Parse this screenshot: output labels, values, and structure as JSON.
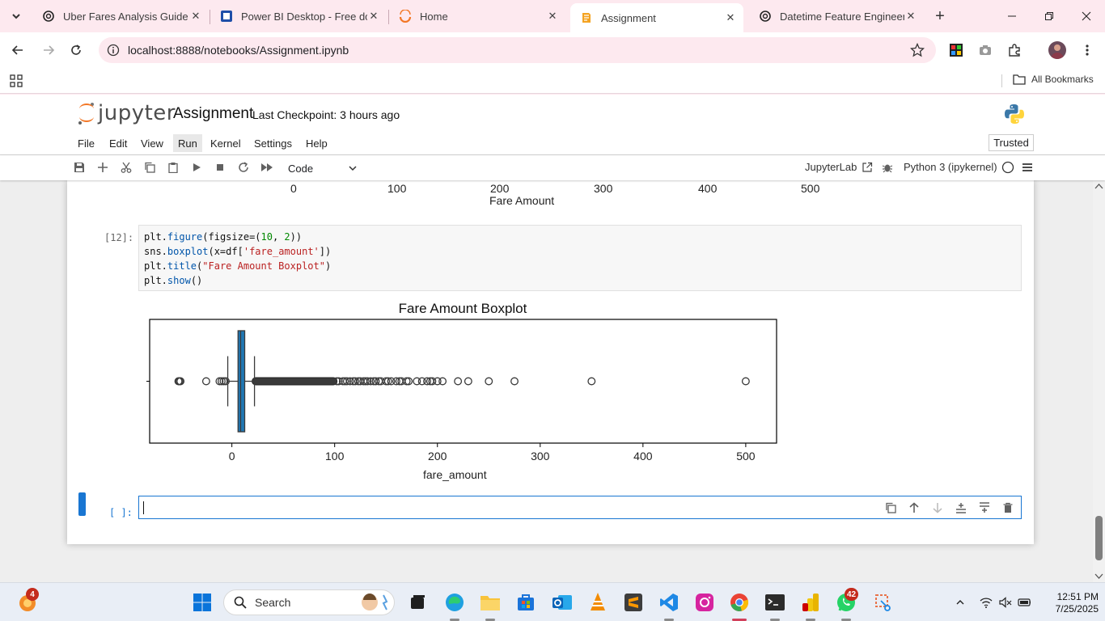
{
  "browser": {
    "tabs": [
      {
        "title": "Uber Fares Analysis Guide",
        "active": false
      },
      {
        "title": "Power BI Desktop - Free download",
        "active": false
      },
      {
        "title": "Home",
        "active": false
      },
      {
        "title": "Assignment",
        "active": true
      },
      {
        "title": "Datetime Feature Engineering",
        "active": false
      }
    ],
    "url": "localhost:8888/notebooks/Assignment.ipynb",
    "bookmarks": {
      "all_label": "All Bookmarks"
    }
  },
  "jupyter": {
    "logo_text": "jupyter",
    "notebook_name": "Assignment",
    "checkpoint": "Last Checkpoint: 3 hours ago",
    "menu": [
      "File",
      "Edit",
      "View",
      "Run",
      "Kernel",
      "Settings",
      "Help"
    ],
    "active_menu": "Run",
    "trusted": "Trusted",
    "cell_type": "Code",
    "jupyterlab_link": "JupyterLab",
    "kernel": "Python 3 (ipykernel)"
  },
  "previous_output": {
    "ticks": [
      "0",
      "100",
      "200",
      "300",
      "400",
      "500"
    ],
    "xlabel": "Fare Amount"
  },
  "code_cell": {
    "prompt": "[12]:",
    "lines": [
      "plt.figure(figsize=(10, 2))",
      "sns.boxplot(x=df['fare_amount'])",
      "plt.title(\"Fare Amount Boxplot\")",
      "plt.show()"
    ]
  },
  "chart_data": {
    "type": "boxplot",
    "title": "Fare Amount Boxplot",
    "xlabel": "fare_amount",
    "ylabel": "",
    "xlim": [
      -80,
      530
    ],
    "xticks": [
      0,
      100,
      200,
      300,
      400,
      500
    ],
    "box": {
      "q1": 6,
      "median": 8.5,
      "q3": 12.5,
      "whisker_low": -4,
      "whisker_high": 22
    },
    "box_color": "#1f77b4",
    "outliers_dense_range": [
      22,
      100
    ],
    "outliers": [
      -52,
      -51,
      -50,
      -25,
      -12,
      -10,
      -8,
      -6,
      102,
      104,
      108,
      110,
      112,
      115,
      118,
      120,
      123,
      125,
      128,
      130,
      132,
      135,
      138,
      140,
      143,
      145,
      150,
      152,
      155,
      160,
      163,
      165,
      170,
      172,
      180,
      185,
      190,
      193,
      195,
      200,
      205,
      220,
      230,
      250,
      275,
      350,
      500
    ]
  },
  "empty_cell": {
    "prompt": "[ ]:"
  },
  "taskbar": {
    "search_label": "Search",
    "badges": {
      "left": "4",
      "whatsapp": "42"
    },
    "time": "12:51 PM",
    "date": "7/25/2025"
  }
}
